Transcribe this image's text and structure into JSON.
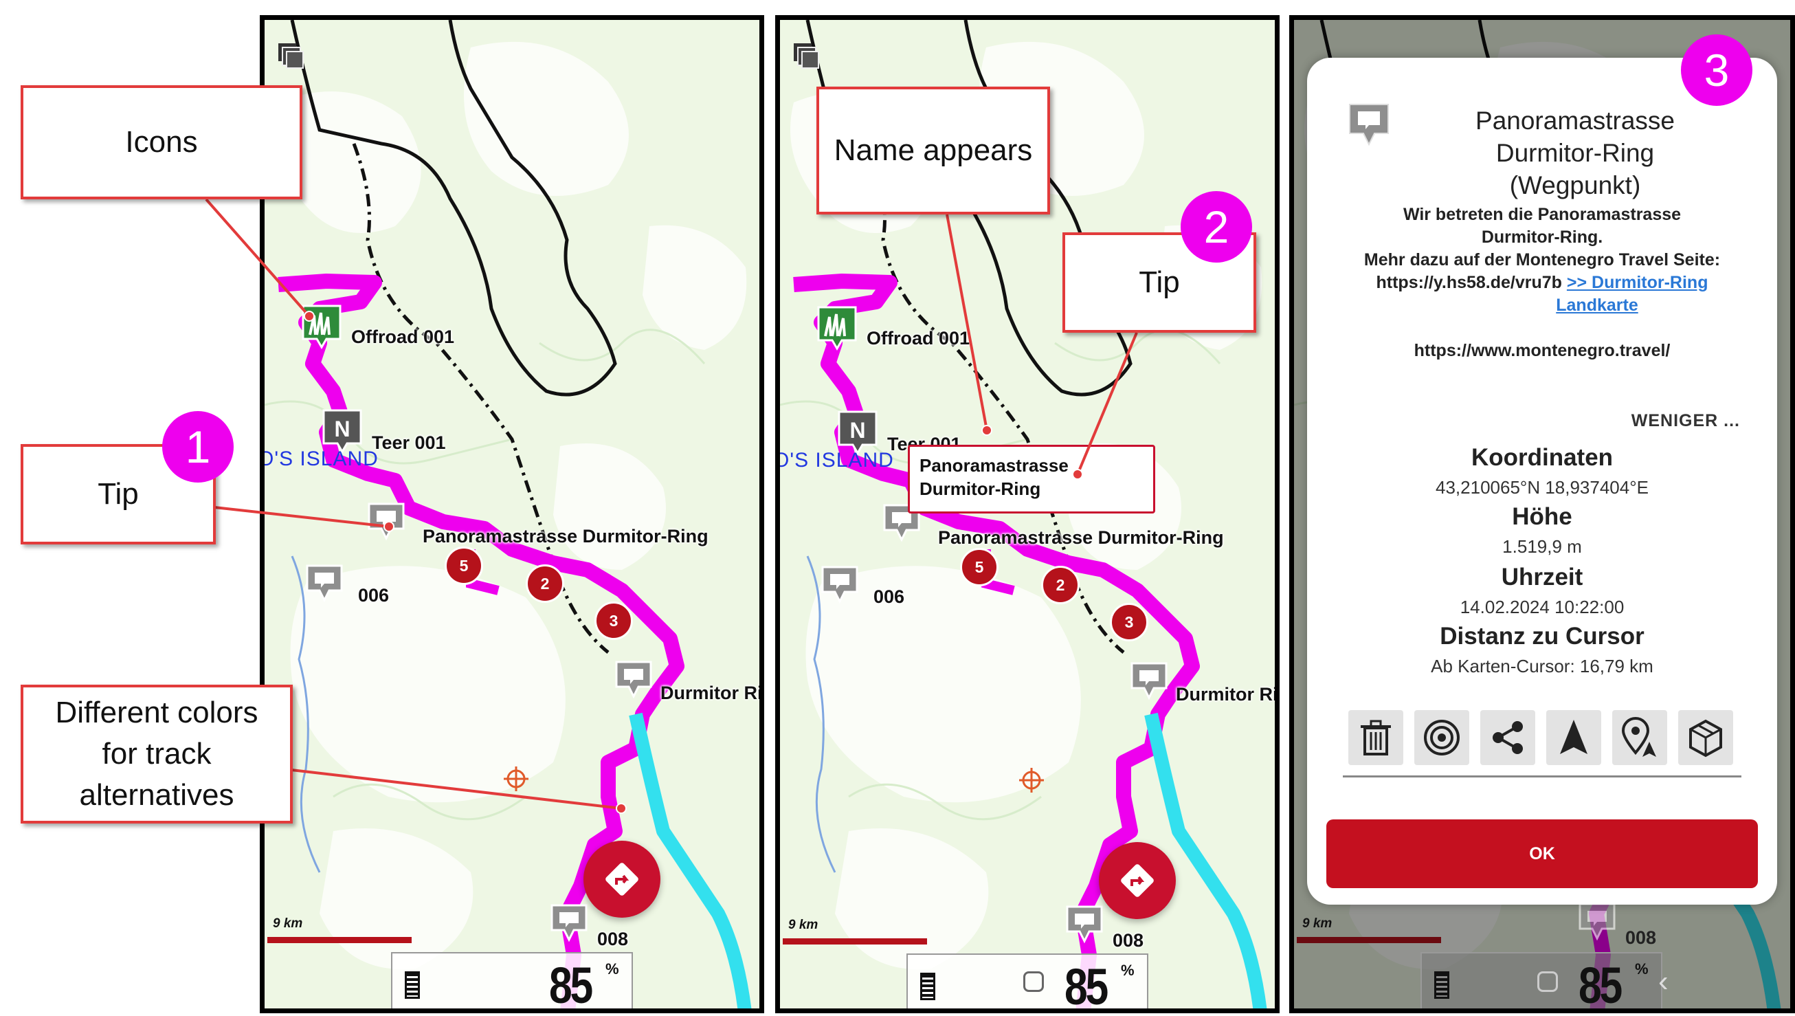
{
  "panels": {
    "p1": {
      "labels": {
        "offroad": "Offroad 001",
        "teer": "Teer 001",
        "island": "O'S ISLAND",
        "panorama": "Panoramastrasse Durmitor-Ring",
        "w006": "006",
        "durmitor": "Durmitor Ri",
        "w008": "008"
      },
      "badges": [
        "5",
        "2",
        "3"
      ],
      "scale": "9 km",
      "speed": {
        "value": "85",
        "unit": "%"
      }
    },
    "p2": {
      "labels": {
        "offroad": "Offroad 001",
        "teer": "Teer 001",
        "island": "O'S ISLAND",
        "panorama": "Panoramastrasse Durmitor-Ring",
        "w006": "006",
        "durmitor": "Durmitor Ri",
        "w008": "008"
      },
      "badges": [
        "5",
        "2",
        "3"
      ],
      "tooltip_line1": "Panoramastrasse",
      "tooltip_line2": "Durmitor-Ring",
      "scale": "9 km",
      "speed": {
        "value": "85",
        "unit": "%"
      }
    },
    "p3": {
      "w008": "008",
      "scale": "9 km",
      "speed": {
        "value": "85",
        "unit": "%"
      }
    }
  },
  "annotations": {
    "icons": "Icons",
    "tip1": "Tip",
    "colors_line1": "Different colors",
    "colors_line2": "for track",
    "colors_line3": "alternatives",
    "name_appears": "Name appears",
    "tip2": "Tip",
    "num1": "1",
    "num2": "2",
    "num3": "3"
  },
  "dialog": {
    "title_line1": "Panoramastrasse",
    "title_line2": "Durmitor-Ring",
    "title_line3": "(Wegpunkt)",
    "desc_line1": "Wir betreten die Panoramastrasse",
    "desc_line2": "Durmitor-Ring.",
    "desc_line3": "Mehr dazu auf der Montenegro Travel Seite:",
    "desc_url": "https://y.hs58.de/vru7b",
    "desc_link1": ">> Durmitor-Ring",
    "desc_link2": "Landkarte",
    "site_url": "https://www.montenegro.travel/",
    "less": "WENIGER ...",
    "coords_label": "Koordinaten",
    "coords_value": "43,210065°N 18,937404°E",
    "height_label": "Höhe",
    "height_value": "1.519,9 m",
    "time_label": "Uhrzeit",
    "time_value": "14.02.2024 10:22:00",
    "distance_label": "Distanz zu Cursor",
    "distance_value": "Ab Karten-Cursor: 16,79 km",
    "tools": [
      "trash-icon",
      "target-icon",
      "share-icon",
      "navigate-icon",
      "place-pin-icon",
      "package-icon"
    ],
    "ok": "OK"
  },
  "colors": {
    "track": "#ee00ee",
    "alt_track": "#33e0ee",
    "accent": "#c4101f",
    "callout_border": "#e23b3b"
  }
}
